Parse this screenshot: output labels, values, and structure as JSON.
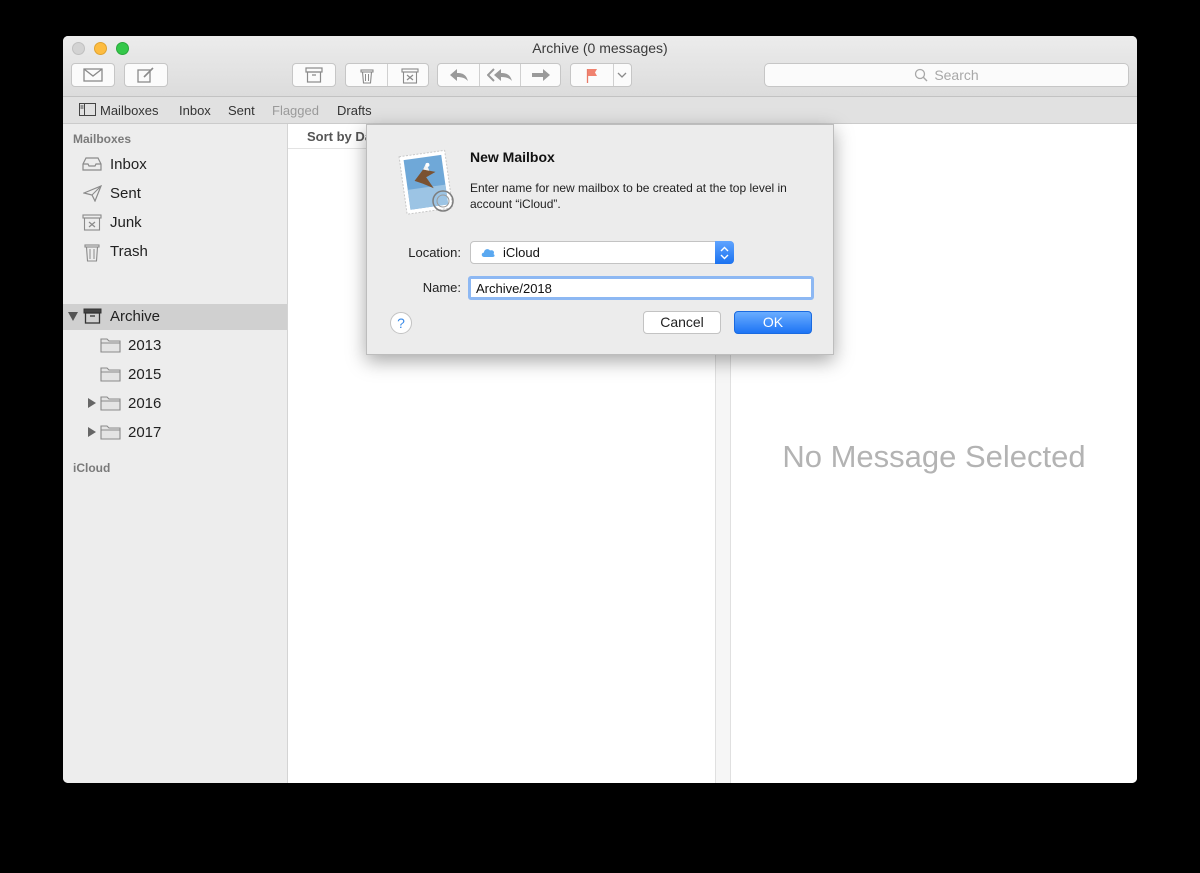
{
  "window": {
    "title": "Archive (0 messages)"
  },
  "toolbar": {
    "buttons": [
      "get-mail",
      "compose",
      "archive",
      "delete",
      "junk",
      "reply",
      "reply-all",
      "forward",
      "flag",
      "flag-menu"
    ],
    "search_placeholder": "Search"
  },
  "favorites": {
    "mailboxes_label": "Mailboxes",
    "items": [
      {
        "label": "Inbox"
      },
      {
        "label": "Sent"
      },
      {
        "label": "Flagged"
      },
      {
        "label": "Drafts"
      }
    ]
  },
  "sidebar": {
    "section_mailboxes": "Mailboxes",
    "items": [
      {
        "label": "Inbox",
        "icon": "inbox-icon"
      },
      {
        "label": "Sent",
        "icon": "paper-plane-icon"
      },
      {
        "label": "Junk",
        "icon": "junk-icon"
      },
      {
        "label": "Trash",
        "icon": "trash-icon"
      },
      {
        "label": "Archive",
        "icon": "archive-box-icon",
        "selected": true
      },
      {
        "label": "2013",
        "icon": "folder-icon"
      },
      {
        "label": "2015",
        "icon": "folder-icon"
      },
      {
        "label": "2016",
        "icon": "folder-icon"
      },
      {
        "label": "2017",
        "icon": "folder-icon"
      }
    ],
    "section_icloud": "iCloud"
  },
  "list": {
    "sort_label": "Sort by Da"
  },
  "viewer": {
    "empty_text": "No Message Selected"
  },
  "dialog": {
    "title": "New Mailbox",
    "message": "Enter name for new mailbox to be created at the top level in account “iCloud”.",
    "location_label": "Location:",
    "location_value": "iCloud",
    "name_label": "Name:",
    "name_value": "Archive/2018",
    "help_label": "?",
    "cancel_label": "Cancel",
    "ok_label": "OK"
  },
  "colors": {
    "accent": "#1d74f5",
    "flag": "#f0826f",
    "traffic_min": "#fdbc40",
    "traffic_max": "#34c84a"
  }
}
